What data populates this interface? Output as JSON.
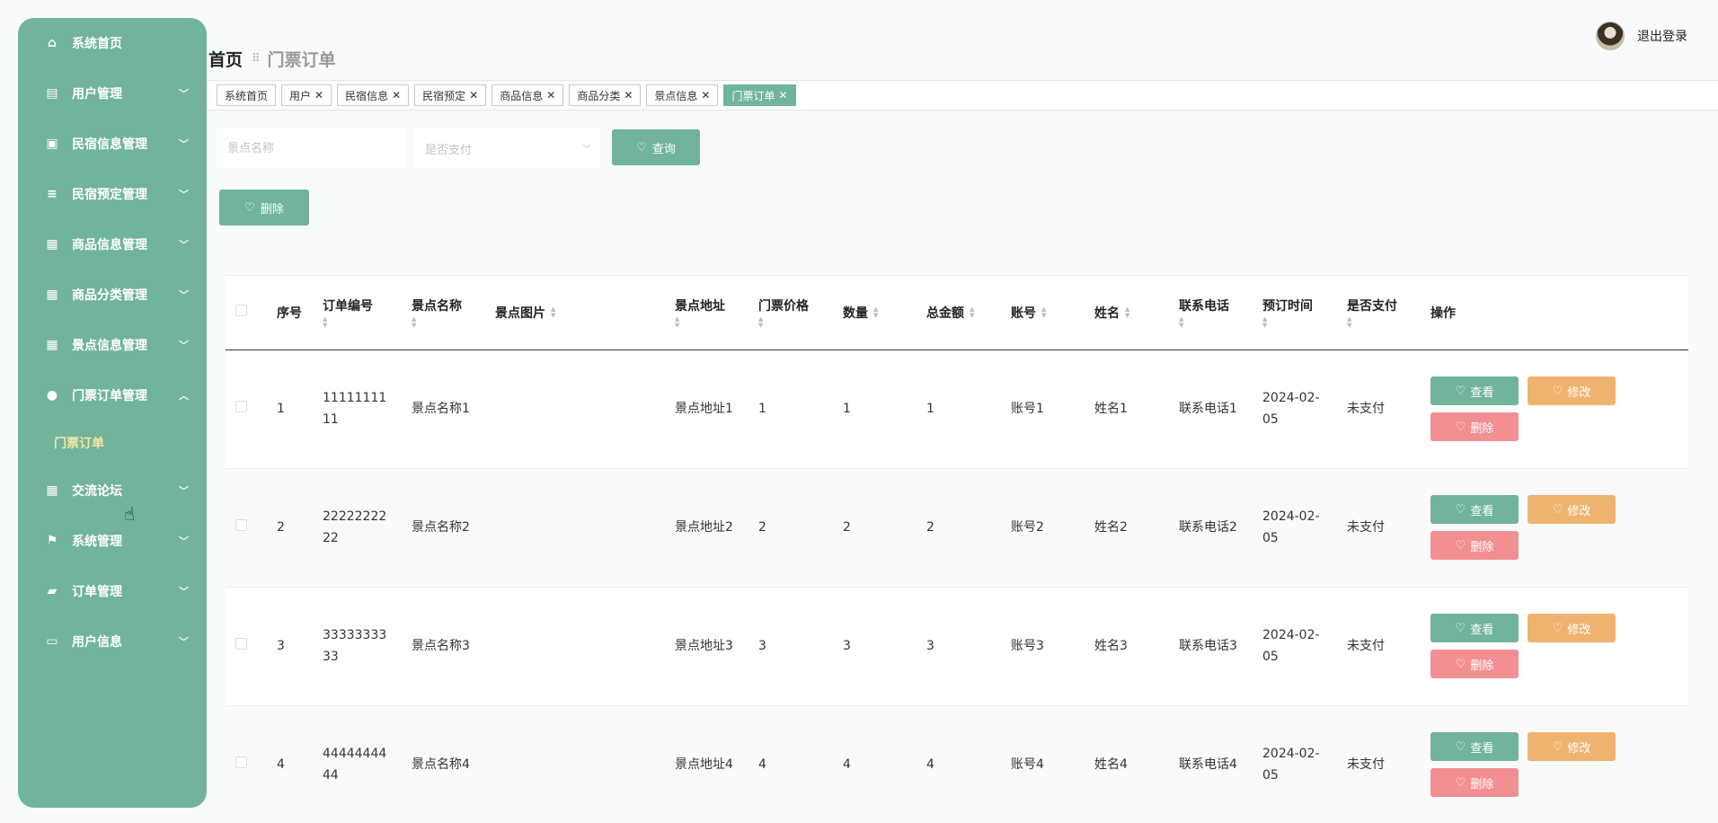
{
  "sidebar": {
    "items": [
      {
        "label": "系统首页",
        "icon": "home-icon",
        "glyph": "⌂",
        "chevron": ""
      },
      {
        "label": "用户管理",
        "icon": "clipboard-icon",
        "glyph": "▤",
        "chevron": "﹀"
      },
      {
        "label": "民宿信息管理",
        "icon": "clipboard-check-icon",
        "glyph": "▣",
        "chevron": "﹀"
      },
      {
        "label": "民宿预定管理",
        "icon": "list-icon",
        "glyph": "≡",
        "chevron": "﹀"
      },
      {
        "label": "商品信息管理",
        "icon": "grid-icon",
        "glyph": "▦",
        "chevron": "﹀"
      },
      {
        "label": "商品分类管理",
        "icon": "grid-icon",
        "glyph": "▦",
        "chevron": "﹀"
      },
      {
        "label": "景点信息管理",
        "icon": "grid-icon",
        "glyph": "▦",
        "chevron": "﹀"
      },
      {
        "label": "门票订单管理",
        "icon": "lightbulb-icon",
        "glyph": "●",
        "chevron": "︿"
      },
      {
        "label": "交流论坛",
        "icon": "grid-icon",
        "glyph": "▦",
        "chevron": "﹀"
      },
      {
        "label": "系统管理",
        "icon": "flag-icon",
        "glyph": "⚑",
        "chevron": "﹀"
      },
      {
        "label": "订单管理",
        "icon": "briefcase-icon",
        "glyph": "▰",
        "chevron": "﹀"
      },
      {
        "label": "用户信息",
        "icon": "card-icon",
        "glyph": "▭",
        "chevron": "﹀"
      }
    ],
    "submenu_label": "门票订单"
  },
  "header": {
    "breadcrumb_home": "首页",
    "breadcrumb_sep": "⠿",
    "breadcrumb_current": "门票订单",
    "logout": "退出登录"
  },
  "tabs": [
    {
      "label": "系统首页",
      "closable": false,
      "active": false
    },
    {
      "label": "用户",
      "closable": true,
      "active": false
    },
    {
      "label": "民宿信息",
      "closable": true,
      "active": false
    },
    {
      "label": "民宿预定",
      "closable": true,
      "active": false
    },
    {
      "label": "商品信息",
      "closable": true,
      "active": false
    },
    {
      "label": "商品分类",
      "closable": true,
      "active": false
    },
    {
      "label": "景点信息",
      "closable": true,
      "active": false
    },
    {
      "label": "门票订单",
      "closable": true,
      "active": true
    }
  ],
  "search": {
    "name_placeholder": "景点名称",
    "paid_placeholder": "是否支付",
    "query_label": "查询",
    "delete_label": "删除"
  },
  "table": {
    "headers": {
      "index": "序号",
      "order_no": "订单编号",
      "spot_name": "景点名称",
      "spot_image": "景点图片",
      "spot_address": "景点地址",
      "ticket_price": "门票价格",
      "quantity": "数量",
      "total": "总金额",
      "account": "账号",
      "name": "姓名",
      "phone": "联系电话",
      "booking_time": "预订时间",
      "paid": "是否支付",
      "actions": "操作"
    },
    "rows": [
      {
        "index": "1",
        "order_no": "1111111111",
        "spot_name": "景点名称1",
        "spot_address": "景点地址1",
        "ticket_price": "1",
        "quantity": "1",
        "total": "1",
        "account": "账号1",
        "name": "姓名1",
        "phone": "联系电话1",
        "booking_time": "2024-02-05",
        "paid": "未支付"
      },
      {
        "index": "2",
        "order_no": "2222222222",
        "spot_name": "景点名称2",
        "spot_address": "景点地址2",
        "ticket_price": "2",
        "quantity": "2",
        "total": "2",
        "account": "账号2",
        "name": "姓名2",
        "phone": "联系电话2",
        "booking_time": "2024-02-05",
        "paid": "未支付"
      },
      {
        "index": "3",
        "order_no": "3333333333",
        "spot_name": "景点名称3",
        "spot_address": "景点地址3",
        "ticket_price": "3",
        "quantity": "3",
        "total": "3",
        "account": "账号3",
        "name": "姓名3",
        "phone": "联系电话3",
        "booking_time": "2024-02-05",
        "paid": "未支付"
      },
      {
        "index": "4",
        "order_no": "4444444444",
        "spot_name": "景点名称4",
        "spot_address": "景点地址4",
        "ticket_price": "4",
        "quantity": "4",
        "total": "4",
        "account": "账号4",
        "name": "姓名4",
        "phone": "联系电话4",
        "booking_time": "2024-02-05",
        "paid": "未支付"
      }
    ],
    "actions": {
      "view": "查看",
      "edit": "修改",
      "delete": "删除"
    }
  },
  "colors": {
    "primary": "#71b49a",
    "edit": "#eeb46f",
    "delete": "#f28f93",
    "submenu_text": "#f7e6a7"
  }
}
